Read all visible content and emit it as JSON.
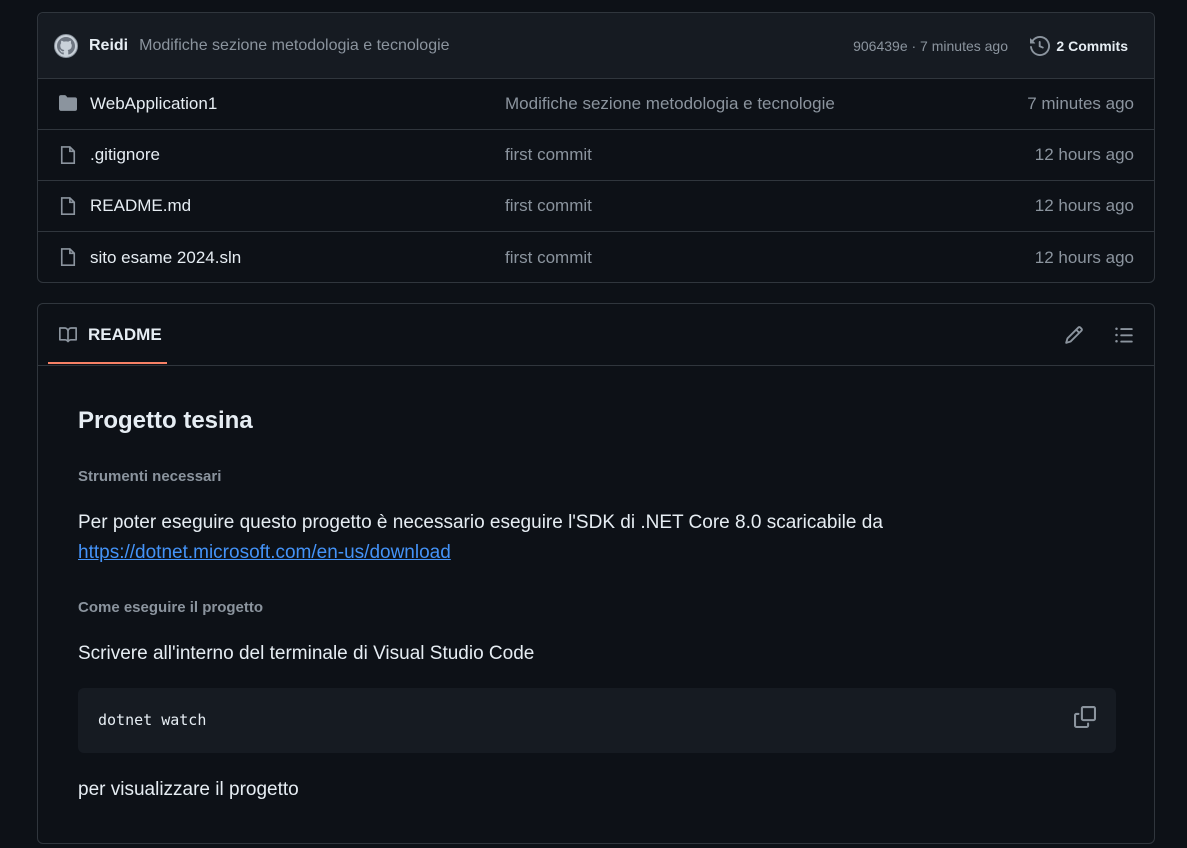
{
  "latest_commit": {
    "author": "Reidi",
    "message": "Modifiche sezione metodologia e tecnologie",
    "sha_time": "906439e · 7 minutes ago",
    "commits_label": "2 Commits"
  },
  "files": [
    {
      "name": "WebApplication1",
      "type": "folder",
      "message": "Modifiche sezione metodologia e tecnologie",
      "age": "7 minutes ago"
    },
    {
      "name": ".gitignore",
      "type": "file",
      "message": "first commit",
      "age": "12 hours ago"
    },
    {
      "name": "README.md",
      "type": "file",
      "message": "first commit",
      "age": "12 hours ago"
    },
    {
      "name": "sito esame 2024.sln",
      "type": "file",
      "message": "first commit",
      "age": "12 hours ago"
    }
  ],
  "readme": {
    "tab_label": "README",
    "title": "Progetto tesina",
    "section1_heading": "Strumenti necessari",
    "section1_text": "Per poter eseguire questo progetto è necessario eseguire l'SDK di .NET Core 8.0 scaricabile da",
    "section1_link": "https://dotnet.microsoft.com/en-us/download",
    "section2_heading": "Come eseguire il progetto",
    "section2_text": "Scrivere all'interno del terminale di Visual Studio Code",
    "code": "dotnet watch",
    "footer_text": "per visualizzare il progetto"
  },
  "colors": {
    "background": "#0d1117",
    "border": "#30363d",
    "accent_tab": "#f78166",
    "link": "#4493f8",
    "muted": "#8b949e"
  }
}
